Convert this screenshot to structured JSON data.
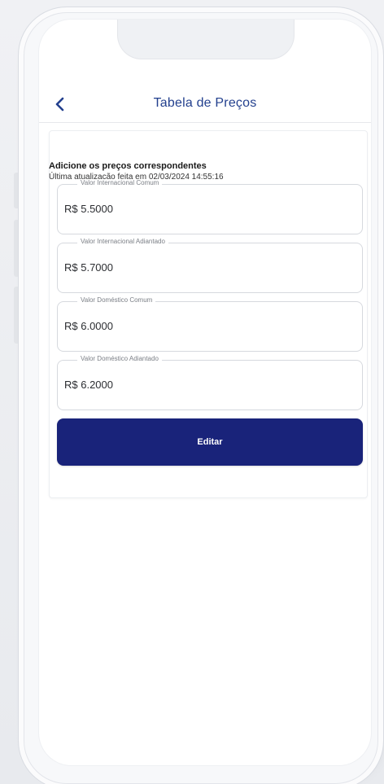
{
  "header": {
    "title": "Tabela de Preços"
  },
  "intro": {
    "title": "Adicione os preços correspondentes",
    "last_update": "Última atualização feita em 02/03/2024 14:55:16"
  },
  "fields": [
    {
      "label": "Valor Internacional Comum",
      "value": "R$ 5.5000"
    },
    {
      "label": "Valor Internacional Adiantado",
      "value": "R$ 5.7000"
    },
    {
      "label": "Valor Doméstico Comum",
      "value": "R$ 6.0000"
    },
    {
      "label": "Valor Doméstico Adiantado",
      "value": "R$ 6.2000"
    }
  ],
  "actions": {
    "edit_label": "Editar"
  },
  "colors": {
    "primary": "#19237a",
    "title_blue": "#23408e"
  },
  "icons": {
    "back": "chevron-left-icon"
  }
}
